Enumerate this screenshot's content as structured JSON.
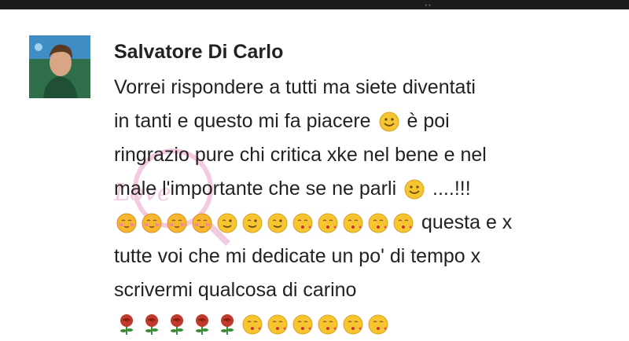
{
  "post": {
    "author": "Salvatore Di Carlo",
    "lines": [
      "Vorrei rispondere a tutti ma siete diventati",
      "in tanti e questo mi fa piacere",
      "è poi",
      "ringrazio pure chi critica xke nel bene e nel",
      "male l'importante che se ne parli",
      "....!!!",
      "questa e x",
      "tutte voi che mi dedicate un po' di tempo x",
      "scrivermi qualcosa di carino"
    ]
  },
  "icons": {
    "smile": "smile-emoji-icon",
    "yum": "yum-face-emoji-icon",
    "wink": "wink-emoji-icon",
    "kiss": "kiss-emoji-icon",
    "rose": "rose-emoji-icon"
  },
  "colors": {
    "emoji_yellow": "#f7c531",
    "rose_red": "#c0392b",
    "leaf_green": "#3a8a3a"
  }
}
